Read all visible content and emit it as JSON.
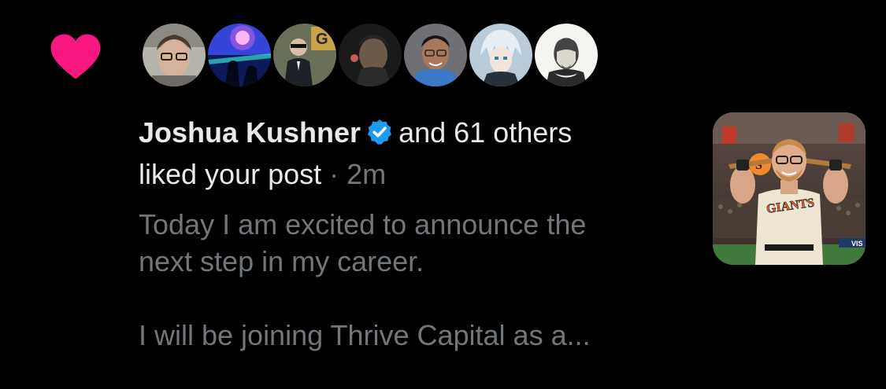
{
  "notification": {
    "icon": "heart-icon",
    "accent_color": "#f91880",
    "liker_name": "Joshua Kushner",
    "verified_badge": "verified-badge-icon",
    "verified_color": "#1d9bf0",
    "others_text": "and 61 others",
    "action_text": "liked your post",
    "separator": "·",
    "timestamp": "2m",
    "post_preview_line1": "Today I am excited to announce the",
    "post_preview_line2": "next step in my career.",
    "post_preview_line3": "I will be joining Thrive Capital as a...",
    "thumbnail_jersey_text": "GIANTS",
    "avatars": [
      "avatar-glasses-man",
      "avatar-neon-scene",
      "avatar-suited-figure",
      "avatar-dark-portrait",
      "avatar-smiling-man",
      "avatar-anime-character",
      "avatar-shakespeare"
    ]
  }
}
